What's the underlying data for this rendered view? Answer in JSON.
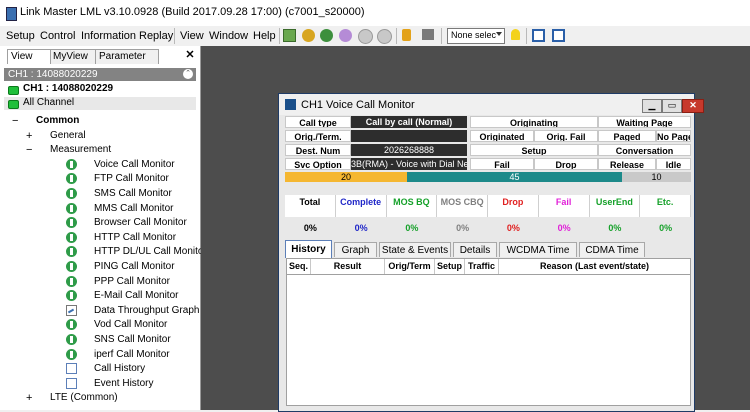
{
  "window": {
    "title": "Link Master LML v3.10.0928 (Build 2017.09.28 17:00) (c7001_s20000)"
  },
  "menu": [
    "Setup",
    "Control",
    "Information",
    "Replay",
    "View",
    "Window",
    "Help"
  ],
  "toolbar": {
    "combo_value": "None selec"
  },
  "panel": {
    "tabs": [
      "View",
      "MyView",
      "Parameter"
    ],
    "close": "✕",
    "channel_header": "CH1 : 14088020229",
    "collapse": "⌃",
    "channels": [
      "CH1 : 14088020229",
      "All Channel"
    ],
    "tree": [
      {
        "label": "Common",
        "exp": "−",
        "indent": 0,
        "icon": "none",
        "bold": true
      },
      {
        "label": "General",
        "exp": "+",
        "indent": 1,
        "icon": "none"
      },
      {
        "label": "Measurement",
        "exp": "−",
        "indent": 1,
        "icon": "none"
      },
      {
        "label": "Voice Call Monitor",
        "indent": 2,
        "icon": "green"
      },
      {
        "label": "FTP Call Monitor",
        "indent": 2,
        "icon": "green"
      },
      {
        "label": "SMS Call Monitor",
        "indent": 2,
        "icon": "green"
      },
      {
        "label": "MMS Call Monitor",
        "indent": 2,
        "icon": "green"
      },
      {
        "label": "Browser Call Monitor",
        "indent": 2,
        "icon": "green"
      },
      {
        "label": "HTTP Call Monitor",
        "indent": 2,
        "icon": "green"
      },
      {
        "label": "HTTP DL/UL Call Monitor",
        "indent": 2,
        "icon": "green"
      },
      {
        "label": "PING Call Monitor",
        "indent": 2,
        "icon": "green"
      },
      {
        "label": "PPP Call Monitor",
        "indent": 2,
        "icon": "green"
      },
      {
        "label": "E-Mail Call Monitor",
        "indent": 2,
        "icon": "green"
      },
      {
        "label": "Data Throughput Graph",
        "indent": 2,
        "icon": "chart"
      },
      {
        "label": "Vod Call Monitor",
        "indent": 2,
        "icon": "green"
      },
      {
        "label": "SNS Call Monitor",
        "indent": 2,
        "icon": "green"
      },
      {
        "label": "iperf Call Monitor",
        "indent": 2,
        "icon": "green"
      },
      {
        "label": "Call History",
        "indent": 2,
        "icon": "doc"
      },
      {
        "label": "Event History",
        "indent": 2,
        "icon": "doc"
      },
      {
        "label": "LTE (Common)",
        "exp": "+",
        "indent": 1,
        "icon": "none"
      }
    ]
  },
  "monitor": {
    "title": "CH1 Voice Call Monitor",
    "buttons": {
      "minimize": "▁",
      "restore": "▭",
      "close": "✕"
    },
    "info": {
      "call_type_label": "Call type",
      "call_type_value": "Call by call (Normal)",
      "orig_term_label": "Orig./Term.",
      "orig_term_value": "",
      "dest_num_label": "Dest. Num",
      "dest_num_value": "2026268888",
      "svc_option_label": "Svc Option",
      "svc_option_value": "3B(RMA) - Voice with Dial Ne",
      "originating": "Originating",
      "originated": "Originated",
      "orig_fail": "Orig. Fail",
      "setup": "Setup",
      "fail": "Fail",
      "drop": "Drop",
      "waiting_page": "Waiting Page",
      "paged": "Paged",
      "no_page": "No Page",
      "conversation": "Conversation",
      "release": "Release",
      "idle": "Idle"
    },
    "status_bar": [
      {
        "value": "20",
        "color": "#f5b731",
        "share": 0.3
      },
      {
        "value": "45",
        "color": "#1d8a8a",
        "share": 0.53
      },
      {
        "value": "10",
        "color": "#c9c9c9",
        "share": 0.17
      }
    ],
    "stats": [
      {
        "label": "Total",
        "value": "0%",
        "color": "#000000"
      },
      {
        "label": "Complete",
        "value": "0%",
        "color": "#2027c8"
      },
      {
        "label": "MOS BQ",
        "value": "0%",
        "color": "#16a12a"
      },
      {
        "label": "MOS CBQ",
        "value": "0%",
        "color": "#808080"
      },
      {
        "label": "Drop",
        "value": "0%",
        "color": "#e02020"
      },
      {
        "label": "Fail",
        "value": "0%",
        "color": "#e020d8"
      },
      {
        "label": "UserEnd",
        "value": "0%",
        "color": "#16a12a"
      },
      {
        "label": "Etc.",
        "value": "0%",
        "color": "#16a12a"
      }
    ],
    "tabs": [
      "History",
      "Graph",
      "State & Events",
      "Details",
      "WCDMA Time",
      "CDMA Time"
    ],
    "table_headers": [
      "Seq.",
      "Result",
      "Orig/Term",
      "Setup",
      "Traffic",
      "Reason (Last event/state)"
    ]
  }
}
